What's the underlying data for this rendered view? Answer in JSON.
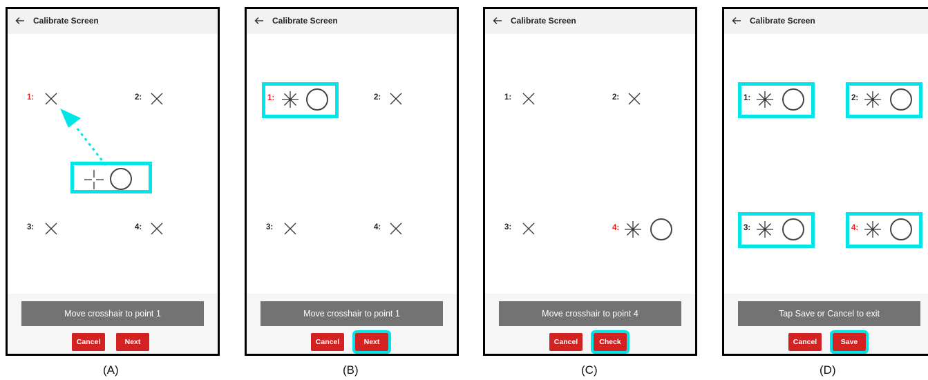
{
  "panels": [
    {
      "caption": "(A)",
      "title": "Calibrate Screen",
      "instruction": "Move crosshair to point 1",
      "cancel_label": "Cancel",
      "action_label": "Next",
      "points": [
        "1:",
        "2:",
        "3:",
        "4:"
      ]
    },
    {
      "caption": "(B)",
      "title": "Calibrate Screen",
      "instruction": "Move crosshair to point 1",
      "cancel_label": "Cancel",
      "action_label": "Next",
      "points": [
        "1:",
        "2:",
        "3:",
        "4:"
      ]
    },
    {
      "caption": "(C)",
      "title": "Calibrate Screen",
      "instruction": "Move crosshair to point 4",
      "cancel_label": "Cancel",
      "action_label": "Check",
      "points": [
        "1:",
        "2:",
        "3:",
        "4:"
      ]
    },
    {
      "caption": "(D)",
      "title": "Calibrate Screen",
      "instruction": "Tap Save or Cancel to exit",
      "cancel_label": "Cancel",
      "action_label": "Save",
      "points": [
        "1:",
        "2:",
        "3:",
        "4:"
      ]
    }
  ],
  "colors": {
    "highlight": "#00e5e8",
    "button": "#d32222",
    "active_label": "#e32222",
    "instruction_bar": "#737373"
  },
  "icons": [
    "back-arrow-icon",
    "x-mark-icon",
    "crosshair-icon",
    "asterisk-icon",
    "circle-icon"
  ]
}
